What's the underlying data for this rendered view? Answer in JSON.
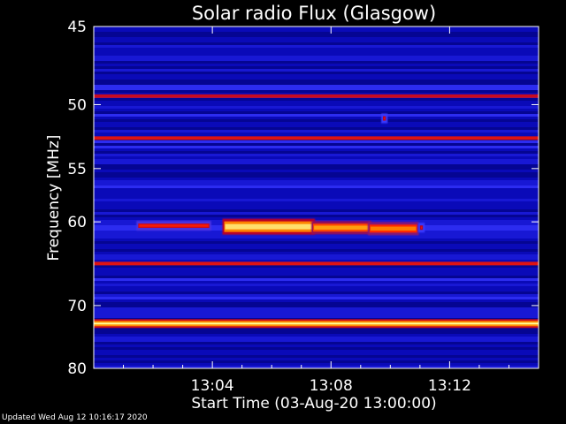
{
  "chart_data": {
    "type": "heatmap",
    "title": "Solar radio Flux (Glasgow)",
    "xlabel": "Start Time (03-Aug-20 13:00:00)",
    "ylabel": "Frequency [MHz]",
    "x_unit": "minutes after 13:00",
    "xlim": [
      0,
      15
    ],
    "ylim": [
      45,
      80
    ],
    "x_ticks": [
      {
        "value": 4,
        "label": "13:04"
      },
      {
        "value": 8,
        "label": "13:08"
      },
      {
        "value": 12,
        "label": "13:12"
      }
    ],
    "y_ticks": [
      {
        "value": 45,
        "label": "45"
      },
      {
        "value": 50,
        "label": "50"
      },
      {
        "value": 55,
        "label": "55"
      },
      {
        "value": 60,
        "label": "60"
      },
      {
        "value": 70,
        "label": "70"
      },
      {
        "value": 80,
        "label": "80"
      }
    ],
    "y_scale": "reciprocal",
    "colormap": [
      "#0000a0",
      "#1414d0",
      "#3a3aff",
      "#b0002c",
      "#ff2000",
      "#ff9600",
      "#ffff9a"
    ],
    "continuous_bands": [
      {
        "freq_mhz": 49.4,
        "intensity": 0.55
      },
      {
        "freq_mhz": 52.5,
        "intensity": 0.6
      },
      {
        "freq_mhz": 64.6,
        "intensity": 0.6
      },
      {
        "freq_mhz": 72.6,
        "intensity": 1.0
      }
    ],
    "bursts": [
      {
        "t_start": 1.5,
        "t_end": 3.9,
        "freq_mhz": 60.4,
        "intensity": 0.65
      },
      {
        "t_start": 4.4,
        "t_end": 7.4,
        "freq_mhz": 60.5,
        "intensity": 0.95
      },
      {
        "t_start": 7.4,
        "t_end": 9.3,
        "freq_mhz": 60.6,
        "intensity": 0.85
      },
      {
        "t_start": 9.3,
        "t_end": 10.9,
        "freq_mhz": 60.7,
        "intensity": 0.8
      },
      {
        "t_start": 11.0,
        "t_end": 11.1,
        "freq_mhz": 60.6,
        "intensity": 0.6
      },
      {
        "t_start": 9.75,
        "t_end": 9.85,
        "freq_mhz": 51.0,
        "intensity": 0.6
      }
    ]
  },
  "footer": {
    "updated": "Updated Wed Aug 12 10:16:17 2020"
  }
}
